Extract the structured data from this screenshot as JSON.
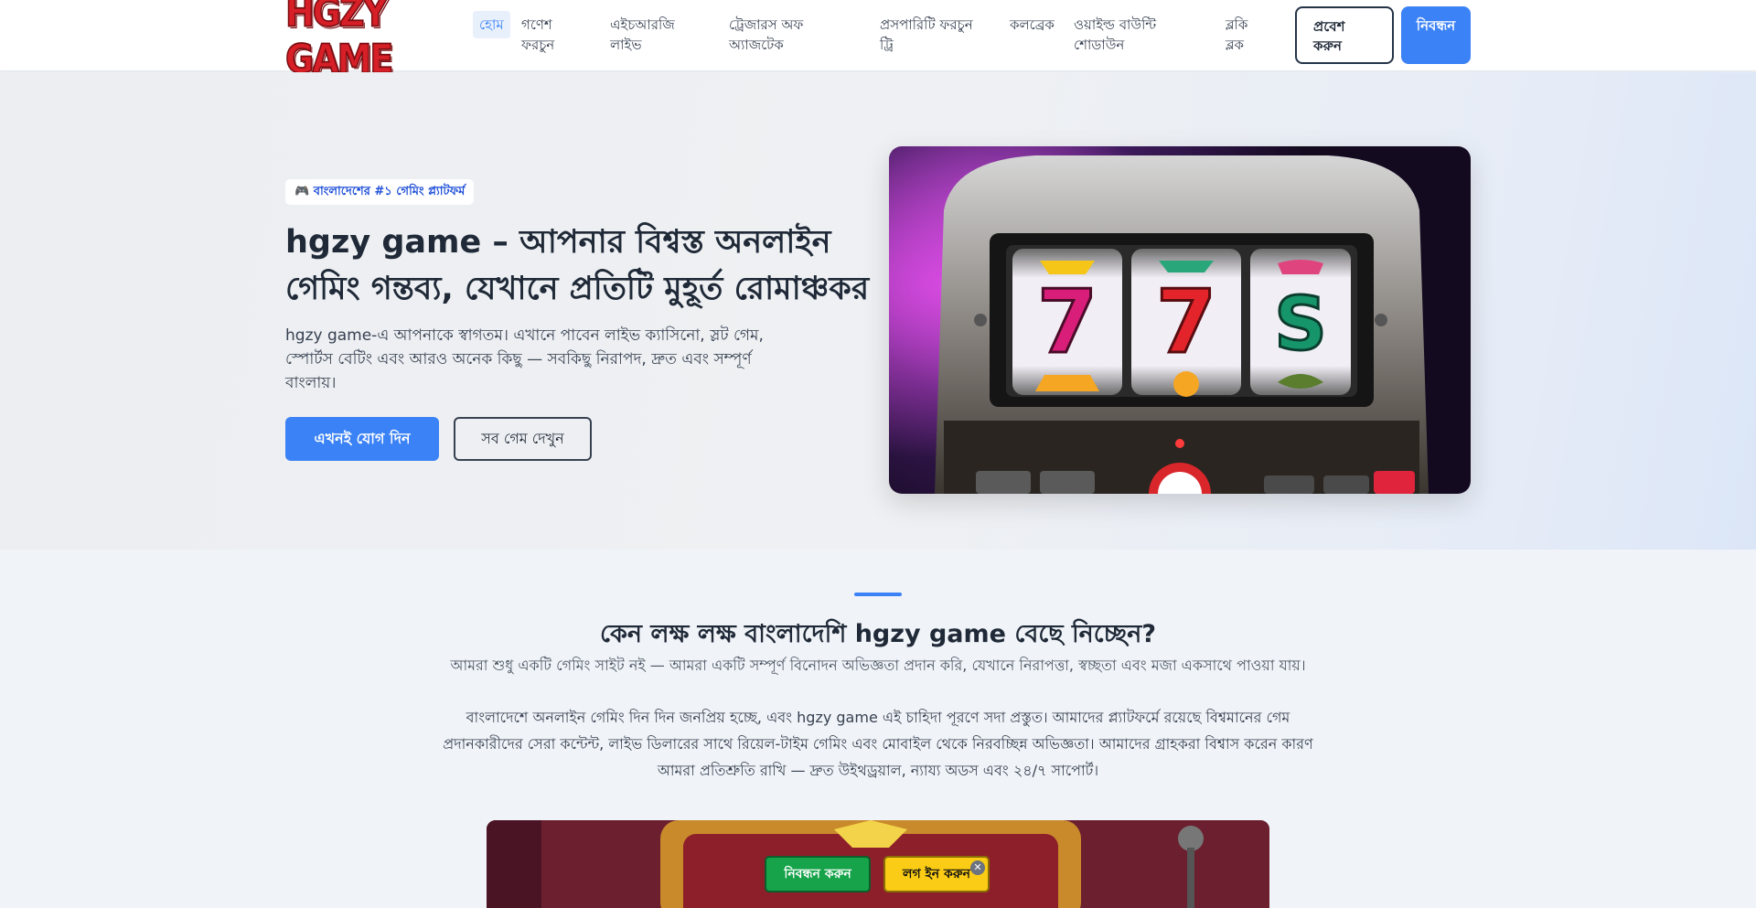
{
  "header": {
    "logo_text": "HGZY GAME",
    "nav": [
      {
        "label": "হোম",
        "active": true
      },
      {
        "label": "গণেশ ফরচুন"
      },
      {
        "label": "এইচআরজি লাইভ"
      },
      {
        "label": "ট্রেজারস অফ অ্যাজটেক"
      },
      {
        "label": "প্রসপারিটি ফরচুন ট্রি"
      },
      {
        "label": "কলব্রেক"
      },
      {
        "label": "ওয়াইল্ড বাউন্টি শোডাউন"
      },
      {
        "label": "ব্লকি ব্লক"
      }
    ],
    "login_label": "প্রবেশ করুন",
    "register_label": "নিবন্ধন"
  },
  "hero": {
    "badge_icon": "gamepad-icon",
    "badge_text": "🎮 বাংলাদেশের #১ গেমিং প্ল্যাটফর্ম",
    "title": "hgzy game – আপনার বিশ্বস্ত অনলাইন গেমিং গন্তব্য, যেখানে প্রতিটি মুহূর্ত রোমাঞ্চকর",
    "description": "hgzy game-এ আপনাকে স্বাগতম। এখানে পাবেন লাইভ ক্যাসিনো, স্লট গেম, স্পোর্টস বেটিং এবং আরও অনেক কিছু — সবকিছু নিরাপদ, দ্রুত এবং সম্পূর্ণ বাংলায়।",
    "join_label": "এখনই যোগ দিন",
    "all_games_label": "সব গেম দেখুন"
  },
  "section": {
    "title": "কেন লক্ষ লক্ষ বাংলাদেশি hgzy game বেছে নিচ্ছেন?",
    "subtitle": "আমরা শুধু একটি গেমিং সাইট নই — আমরা একটি সম্পূর্ণ বিনোদন অভিজ্ঞতা প্রদান করি, যেখানে নিরাপত্তা, স্বচ্ছতা এবং মজা একসাথে পাওয়া যায়।",
    "body": "বাংলাদেশে অনলাইন গেমিং দিন দিন জনপ্রিয় হচ্ছে, এবং hgzy game এই চাহিদা পূরণে সদা প্রস্তুত। আমাদের প্ল্যাটফর্মে রয়েছে বিশ্বমানের গেম প্রদানকারীদের সেরা কন্টেন্ট, লাইভ ডিলারের সাথে রিয়েল-টাইম গেমিং এবং মোবাইল থেকে নিরবচ্ছিন্ন অভিজ্ঞতা। আমাদের গ্রাহকরা বিশ্বাস করেন কারণ আমরা প্রতিশ্রুতি রাখি — দ্রুত উইথড্রয়াল, ন্যায্য অডস এবং ২৪/৭ সাপোর্ট।"
  },
  "floating": {
    "register_label": "নিবন্ধন করুন",
    "login_label": "লগ ইন করুন",
    "close_symbol": "✕"
  },
  "colors": {
    "accent": "#3b82f6",
    "logo_red": "#d61f26",
    "float_green": "#16a34a",
    "float_yellow": "#facc15"
  }
}
